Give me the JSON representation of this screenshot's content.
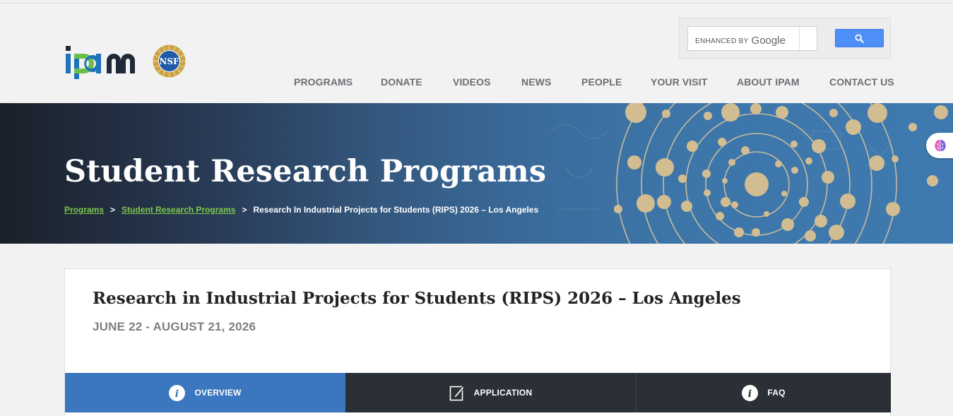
{
  "brand": {
    "logo_text": "ipam",
    "partner_seal": "NSF"
  },
  "search": {
    "placeholder_prefix": "ENHANCED BY",
    "placeholder_brand": "Google",
    "button_icon": "search-icon"
  },
  "nav": {
    "items": [
      "PROGRAMS",
      "DONATE",
      "VIDEOS",
      "NEWS",
      "PEOPLE",
      "YOUR VISIT",
      "ABOUT IPAM",
      "CONTACT US"
    ]
  },
  "hero": {
    "title": "Student Research Programs",
    "breadcrumb": {
      "link1": "Programs",
      "link2": "Student Research Programs",
      "current": "Research In Industrial Projects for Students (RIPS) 2026 – Los Angeles",
      "separator": ">"
    },
    "side_widget_icon": "brain-icon"
  },
  "program": {
    "title": "Research in Industrial Projects for Students (RIPS) 2026 – Los Angeles",
    "dates": "JUNE 22 - AUGUST 21, 2026"
  },
  "tabs": [
    {
      "label": "OVERVIEW",
      "icon": "info-icon",
      "active": true
    },
    {
      "label": "APPLICATION",
      "icon": "edit-icon",
      "active": false
    },
    {
      "label": "FAQ",
      "icon": "info-icon",
      "active": false
    }
  ],
  "colors": {
    "nav_text": "#6b6e73",
    "breadcrumb_link": "#7ec84a",
    "tab_active": "#3a77bf",
    "tab_inactive": "#2b2f36",
    "search_button": "#4d8ef7",
    "logo_blue": "#1e74bb",
    "logo_green": "#6abf4b"
  }
}
